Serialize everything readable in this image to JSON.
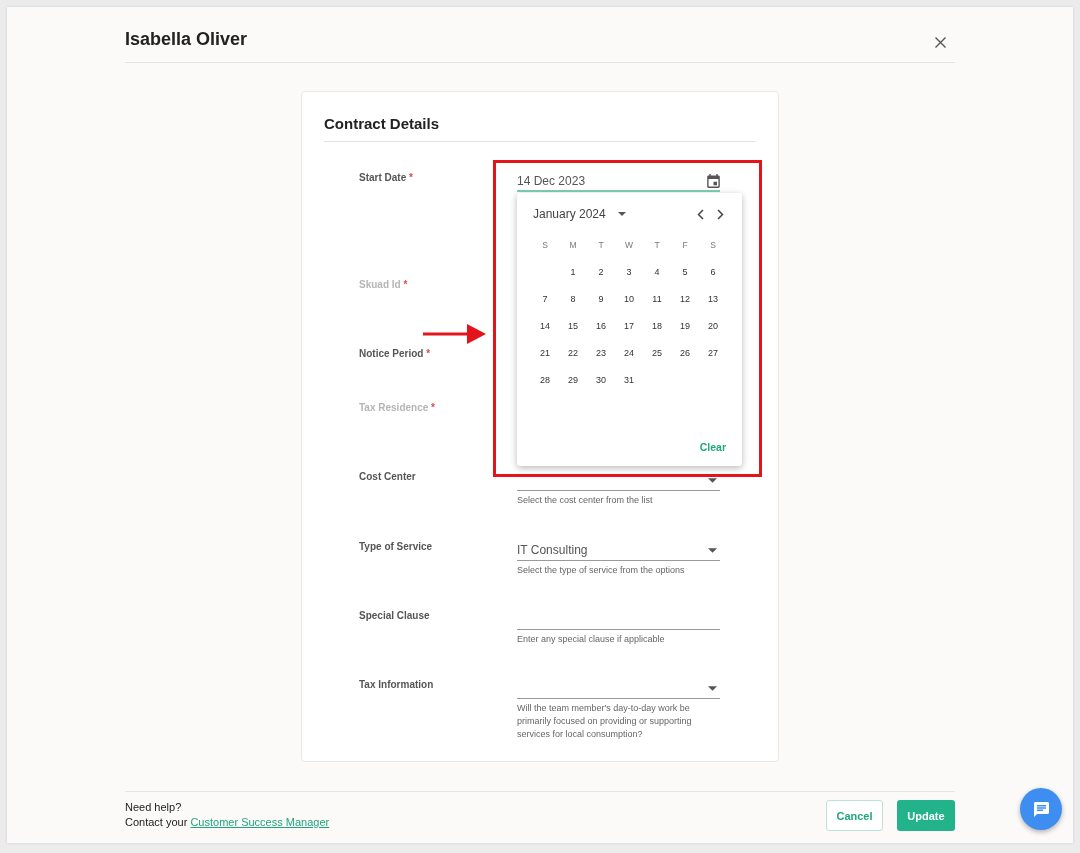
{
  "dialog": {
    "title": "Isabella Oliver"
  },
  "card": {
    "title": "Contract Details"
  },
  "fields": [
    {
      "label": "Start Date",
      "required_mark": "*",
      "disabled": false,
      "focused": true,
      "kind": "date",
      "value": "14 Dec 2023"
    },
    {
      "label": "Skuad Id",
      "required_mark": "*",
      "disabled": true,
      "kind": "covered"
    },
    {
      "label": "Notice Period",
      "required_mark": "*",
      "disabled": false,
      "kind": "covered"
    },
    {
      "label": "Tax Residence",
      "required_mark": "*",
      "disabled": true,
      "kind": "covered"
    },
    {
      "label": "Cost Center",
      "disabled": false,
      "focused": false,
      "kind": "select",
      "helper": "Select the cost center from the list"
    },
    {
      "label": "Type of Service",
      "disabled": false,
      "focused": false,
      "kind": "select",
      "value": "IT Consulting",
      "helper": "Select the type of service from the options"
    },
    {
      "label": "Special Clause",
      "disabled": false,
      "focused": false,
      "kind": "text",
      "helper": "Enter any special clause if applicable"
    },
    {
      "label": "Tax Information",
      "disabled": false,
      "focused": false,
      "kind": "select",
      "helper": "Will the team member's day-to-day work be primarily focused on providing or supporting services for local consumption?"
    }
  ],
  "date_picker": {
    "open": true,
    "month": "January 2024",
    "weekdays": [
      "S",
      "M",
      "T",
      "W",
      "T",
      "F",
      "S"
    ],
    "weeks": [
      [
        "1",
        "2",
        "3",
        "4",
        "5",
        "6"
      ],
      [
        "7",
        "8",
        "9",
        "10",
        "11",
        "12",
        "13"
      ],
      [
        "14",
        "15",
        "16",
        "17",
        "18",
        "19",
        "20"
      ],
      [
        "21",
        "22",
        "23",
        "24",
        "25",
        "26",
        "27"
      ],
      [
        "28",
        "29",
        "30",
        "31"
      ]
    ],
    "clear_label": "Clear"
  },
  "annotations": {
    "highlight_frame": true,
    "pointer_arrow": true
  },
  "footer": {
    "help_title": "Need help?",
    "help_text": "Contact your",
    "help_link": "Customer Success Manager",
    "buttons": [
      {
        "label": "Cancel",
        "kind": "secondary"
      },
      {
        "label": "Update",
        "kind": "primary"
      }
    ]
  }
}
